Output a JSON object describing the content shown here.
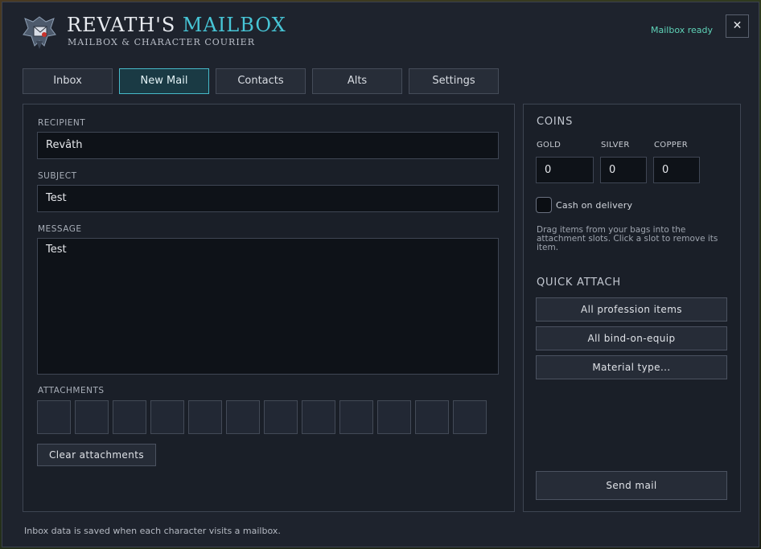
{
  "header": {
    "title_main": "REVATH'S ",
    "title_accent": "MAILBOX",
    "subtitle": "MAILBOX & CHARACTER COURIER",
    "status": "Mailbox ready",
    "close_symbol": "✕",
    "crest_icon": "mailbox-crest-icon"
  },
  "tabs": [
    {
      "label": "Inbox",
      "active": false
    },
    {
      "label": "New Mail",
      "active": true
    },
    {
      "label": "Contacts",
      "active": false
    },
    {
      "label": "Alts",
      "active": false
    },
    {
      "label": "Settings",
      "active": false
    }
  ],
  "compose": {
    "recipient_label": "RECIPIENT",
    "recipient_value": "Revâth",
    "subject_label": "SUBJECT",
    "subject_value": "Test",
    "message_label": "MESSAGE",
    "message_value": "Test",
    "attachments_label": "ATTACHMENTS",
    "attachment_slot_count": 12,
    "clear_button": "Clear attachments"
  },
  "coins": {
    "title": "COINS",
    "gold_label": "GOLD",
    "gold_value": "0",
    "silver_label": "SILVER",
    "silver_value": "0",
    "copper_label": "COPPER",
    "copper_value": "0",
    "cod_label": "Cash on delivery",
    "cod_checked": false,
    "hint": "Drag items from your bags into the attachment slots. Click a slot to remove its item."
  },
  "quick_attach": {
    "title": "QUICK ATTACH",
    "buttons": [
      "All profession items",
      "All bind-on-equip",
      "Material type..."
    ]
  },
  "send_button": "Send mail",
  "footer": "Inbox data is saved when each character visits a mailbox.",
  "colors": {
    "accent": "#47c5d6",
    "status": "#5fd3b8",
    "background": "#1e232d"
  }
}
